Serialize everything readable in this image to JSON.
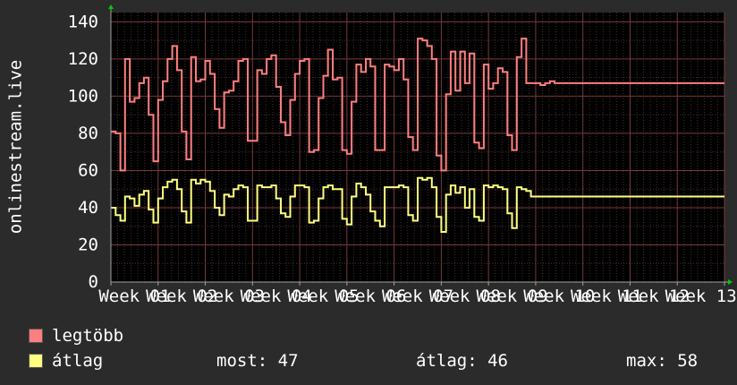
{
  "chart_data": {
    "type": "line",
    "ylabel": "onlinestream.live",
    "ylim": [
      0,
      145
    ],
    "yticks": [
      0,
      20,
      40,
      60,
      80,
      100,
      120,
      140
    ],
    "x_week_labels": [
      "Week 01",
      "Week 02",
      "Week 03",
      "Week 04",
      "Week 05",
      "Week 06",
      "Week 07",
      "Week 08",
      "Week 09",
      "Week 10",
      "Week 11",
      "Week 12",
      "Week 13"
    ],
    "grid": true,
    "legend_placement": "bottom",
    "series": [
      {
        "name": "legtöbb",
        "color": "#ff7f7f",
        "x": [
          0,
          0.1,
          0.2,
          0.3,
          0.4,
          0.5,
          0.6,
          0.7,
          0.8,
          0.9,
          1.0,
          1.1,
          1.2,
          1.3,
          1.4,
          1.5,
          1.6,
          1.7,
          1.8,
          1.9,
          2.0,
          2.1,
          2.2,
          2.3,
          2.4,
          2.5,
          2.6,
          2.7,
          2.8,
          2.9,
          3.0,
          3.1,
          3.2,
          3.3,
          3.4,
          3.5,
          3.6,
          3.7,
          3.8,
          3.9,
          4.0,
          4.1,
          4.2,
          4.3,
          4.4,
          4.5,
          4.6,
          4.7,
          4.8,
          4.9,
          5.0,
          5.1,
          5.2,
          5.3,
          5.4,
          5.5,
          5.6,
          5.7,
          5.8,
          5.9,
          6.0,
          6.1,
          6.2,
          6.3,
          6.4,
          6.5,
          6.6,
          6.7,
          6.8,
          6.9,
          7.0,
          7.1,
          7.2,
          7.3,
          7.4,
          7.5,
          7.6,
          7.7,
          7.8,
          7.9,
          8.0,
          8.1,
          8.2,
          8.3,
          8.4,
          8.5,
          8.6,
          8.7,
          8.8,
          8.9,
          9.0,
          9.1,
          9.2,
          9.3,
          9.4,
          9.5,
          9.6,
          9.7,
          9.8,
          9.9,
          10.0,
          10.1,
          10.2,
          10.3,
          10.4,
          10.5,
          10.6,
          10.7,
          10.8,
          10.9,
          11.0,
          11.1,
          11.2,
          11.3,
          11.4,
          11.5,
          11.6,
          11.7,
          11.8,
          11.9,
          12.0,
          12.1,
          12.2,
          12.3,
          12.4,
          12.5,
          12.6,
          12.7,
          12.8,
          12.9,
          13.0
        ],
        "values": [
          81,
          80,
          60,
          120,
          97,
          99,
          107,
          110,
          90,
          65,
          98,
          108,
          120,
          127,
          114,
          81,
          66,
          121,
          108,
          109,
          119,
          112,
          93,
          83,
          102,
          103,
          108,
          119,
          120,
          76,
          76,
          114,
          112,
          120,
          122,
          105,
          86,
          79,
          98,
          112,
          119,
          120,
          70,
          71,
          99,
          111,
          125,
          109,
          110,
          71,
          69,
          97,
          117,
          113,
          120,
          116,
          71,
          71,
          117,
          116,
          114,
          120,
          109,
          78,
          71,
          131,
          130,
          127,
          120,
          68,
          60,
          101,
          124,
          103,
          124,
          107,
          123,
          75,
          72,
          117,
          104,
          107,
          115,
          113,
          79,
          71,
          121,
          131,
          107,
          107,
          107,
          106,
          107,
          108,
          107,
          107,
          107,
          107,
          107,
          107,
          107,
          107,
          107,
          107,
          107,
          107,
          107,
          107,
          107,
          107,
          107,
          107,
          107,
          107,
          107,
          107,
          107,
          107,
          107,
          107,
          107,
          107,
          107,
          107,
          107,
          107,
          107,
          107,
          107,
          107,
          107
        ]
      },
      {
        "name": "átlag",
        "color": "#ffff80",
        "x": [
          0,
          0.1,
          0.2,
          0.3,
          0.4,
          0.5,
          0.6,
          0.7,
          0.8,
          0.9,
          1.0,
          1.1,
          1.2,
          1.3,
          1.4,
          1.5,
          1.6,
          1.7,
          1.8,
          1.9,
          2.0,
          2.1,
          2.2,
          2.3,
          2.4,
          2.5,
          2.6,
          2.7,
          2.8,
          2.9,
          3.0,
          3.1,
          3.2,
          3.3,
          3.4,
          3.5,
          3.6,
          3.7,
          3.8,
          3.9,
          4.0,
          4.1,
          4.2,
          4.3,
          4.4,
          4.5,
          4.6,
          4.7,
          4.8,
          4.9,
          5.0,
          5.1,
          5.2,
          5.3,
          5.4,
          5.5,
          5.6,
          5.7,
          5.8,
          5.9,
          6.0,
          6.1,
          6.2,
          6.3,
          6.4,
          6.5,
          6.6,
          6.7,
          6.8,
          6.9,
          7.0,
          7.1,
          7.2,
          7.3,
          7.4,
          7.5,
          7.6,
          7.7,
          7.8,
          7.9,
          8.0,
          8.1,
          8.2,
          8.3,
          8.4,
          8.5,
          8.6,
          8.7,
          8.8,
          8.9,
          9.0,
          9.1,
          9.2,
          9.3,
          9.4,
          9.5,
          9.6,
          9.7,
          9.8,
          9.9,
          10.0,
          10.1,
          10.2,
          10.3,
          10.4,
          10.5,
          10.6,
          10.7,
          10.8,
          10.9,
          11.0,
          11.1,
          11.2,
          11.3,
          11.4,
          11.5,
          11.6,
          11.7,
          11.8,
          11.9,
          12.0,
          12.1,
          12.2,
          12.3,
          12.4,
          12.5,
          12.6,
          12.7,
          12.8,
          12.9,
          13.0
        ],
        "values": [
          40,
          36,
          33,
          46,
          45,
          41,
          47,
          49,
          39,
          32,
          45,
          51,
          54,
          55,
          50,
          38,
          32,
          55,
          53,
          55,
          54,
          49,
          40,
          36,
          47,
          46,
          50,
          52,
          51,
          33,
          33,
          52,
          51,
          51,
          52,
          45,
          37,
          35,
          46,
          52,
          52,
          51,
          32,
          33,
          45,
          51,
          52,
          50,
          50,
          34,
          31,
          46,
          53,
          51,
          47,
          38,
          33,
          30,
          51,
          51,
          51,
          52,
          51,
          36,
          33,
          56,
          55,
          56,
          51,
          35,
          27,
          47,
          52,
          48,
          51,
          40,
          50,
          35,
          33,
          52,
          51,
          52,
          51,
          50,
          37,
          29,
          51,
          50,
          49,
          46,
          46,
          46,
          46,
          46,
          46,
          46,
          46,
          46,
          46,
          46,
          46,
          46,
          46,
          46,
          46,
          46,
          46,
          46,
          46,
          46,
          46,
          46,
          46,
          46,
          46,
          46,
          46,
          46,
          46,
          46,
          46,
          46,
          46,
          46,
          46,
          46,
          46,
          46,
          46,
          46,
          46
        ]
      }
    ]
  },
  "legend": {
    "items": [
      {
        "label": "legtöbb",
        "color": "#ff7f7f"
      },
      {
        "label": "átlag",
        "color": "#ffff80"
      }
    ],
    "stats": {
      "now": "most: 47",
      "avg": "átlag: 46",
      "max": "max: 58"
    }
  }
}
